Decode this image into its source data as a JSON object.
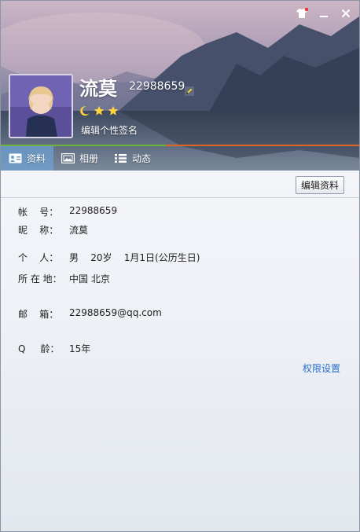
{
  "window": {
    "controls": [
      {
        "name": "skin-icon"
      },
      {
        "name": "minimize-icon"
      },
      {
        "name": "close-icon"
      }
    ]
  },
  "profile": {
    "nickname": "流莫",
    "qq_number": "22988659",
    "level_icons": [
      "moon",
      "star",
      "star"
    ],
    "signature_placeholder": "编辑个性签名"
  },
  "tabs": [
    {
      "label": "资料",
      "icon": "profile-card-icon",
      "active": true
    },
    {
      "label": "相册",
      "icon": "photo-album-icon",
      "active": false
    },
    {
      "label": "动态",
      "icon": "feed-list-icon",
      "active": false
    }
  ],
  "toolbar": {
    "edit_label": "编辑资料"
  },
  "info": {
    "account_label": "帐    号：",
    "account_value": "22988659",
    "nickname_label": "昵    称：",
    "nickname_value": "流莫",
    "personal_label": "个    人：",
    "personal_value": "男    20岁    1月1日(公历生日)",
    "location_label": "所 在 地：",
    "location_value": "中国 北京",
    "email_label": "邮    箱：",
    "email_value": "22988659@qq.com",
    "qage_label": "Q     龄：",
    "qage_value": "15年"
  },
  "permission_link": "权限设置",
  "colors": {
    "progress_done": "#6bb53a",
    "progress_rest": "#e06422",
    "link": "#2a6fc9",
    "active_tab": "#6ea0d2"
  }
}
